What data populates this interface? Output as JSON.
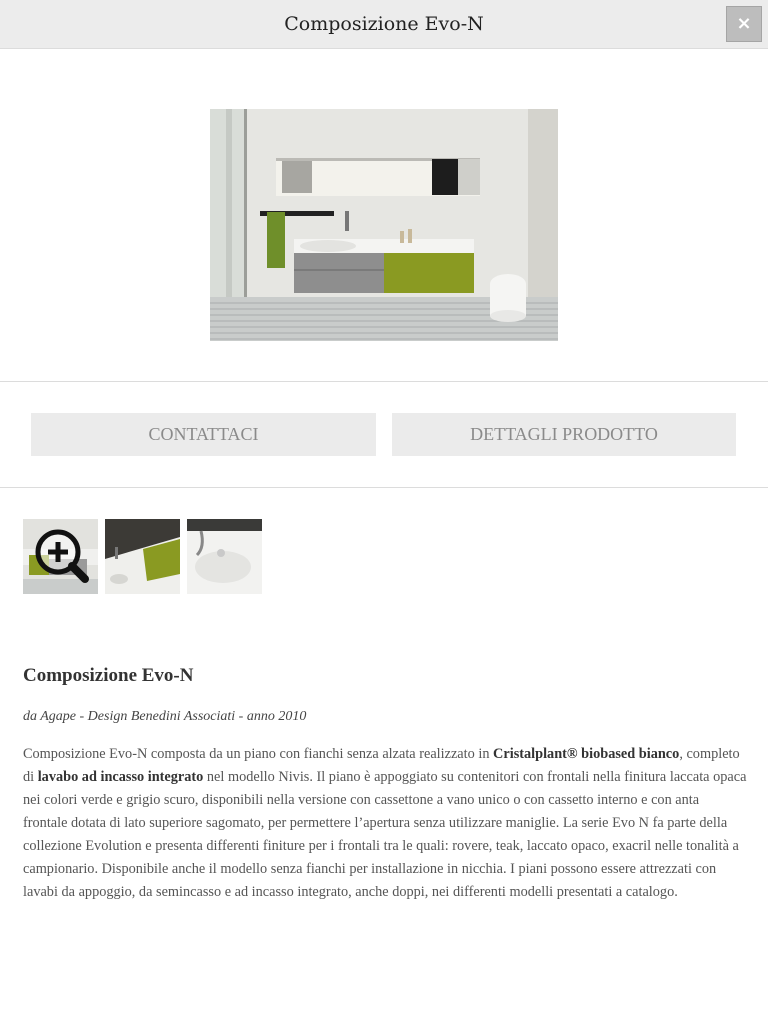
{
  "header": {
    "title": "Composizione Evo-N",
    "close_label": "×"
  },
  "hero_image": {
    "icon": "bathroom-vanity-photo"
  },
  "actions": {
    "contact_label": "CONTATTACI",
    "details_label": "DETTAGLI PRODOTTO"
  },
  "gallery": {
    "zoom_icon": "zoom-in-icon",
    "thumbnails": [
      "thumbnail-1",
      "thumbnail-2",
      "thumbnail-3"
    ]
  },
  "product": {
    "title": "Composizione Evo-N",
    "subtitle": "da Agape - Design Benedini Associati - anno 2010",
    "desc": {
      "p1": "Composizione Evo-N composta da un piano con fianchi senza alzata realizzato in ",
      "b1": "Cristalplant® biobased bianco",
      "p2": ", completo di ",
      "b2": "lavabo ad incasso integrato",
      "p3": " nel modello Nivis. Il piano è appoggiato su contenitori con frontali nella finitura laccata opaca nei colori verde e grigio scuro, disponibili nella versione con cassettone a vano unico o con cassetto interno e con anta frontale dotata di lato superiore sagomato, per permettere l’apertura senza utilizzare maniglie. La serie Evo N fa parte della collezione Evolution e presenta differenti finiture per i frontali tra le quali: rovere, teak, laccato opaco, exacril nelle tonalità a campionario. Disponibile anche il modello senza fianchi per installazione in nicchia. I piani possono essere attrezzati con lavabi da appoggio, da semincasso e ad incasso integrato, anche doppi, nei differenti modelli presentati a catalogo."
    }
  },
  "colors": {
    "topbar": "#ececec",
    "button_bg": "#ebebeb",
    "button_text": "#8a8a8a",
    "accent_green": "#8a9a22"
  }
}
